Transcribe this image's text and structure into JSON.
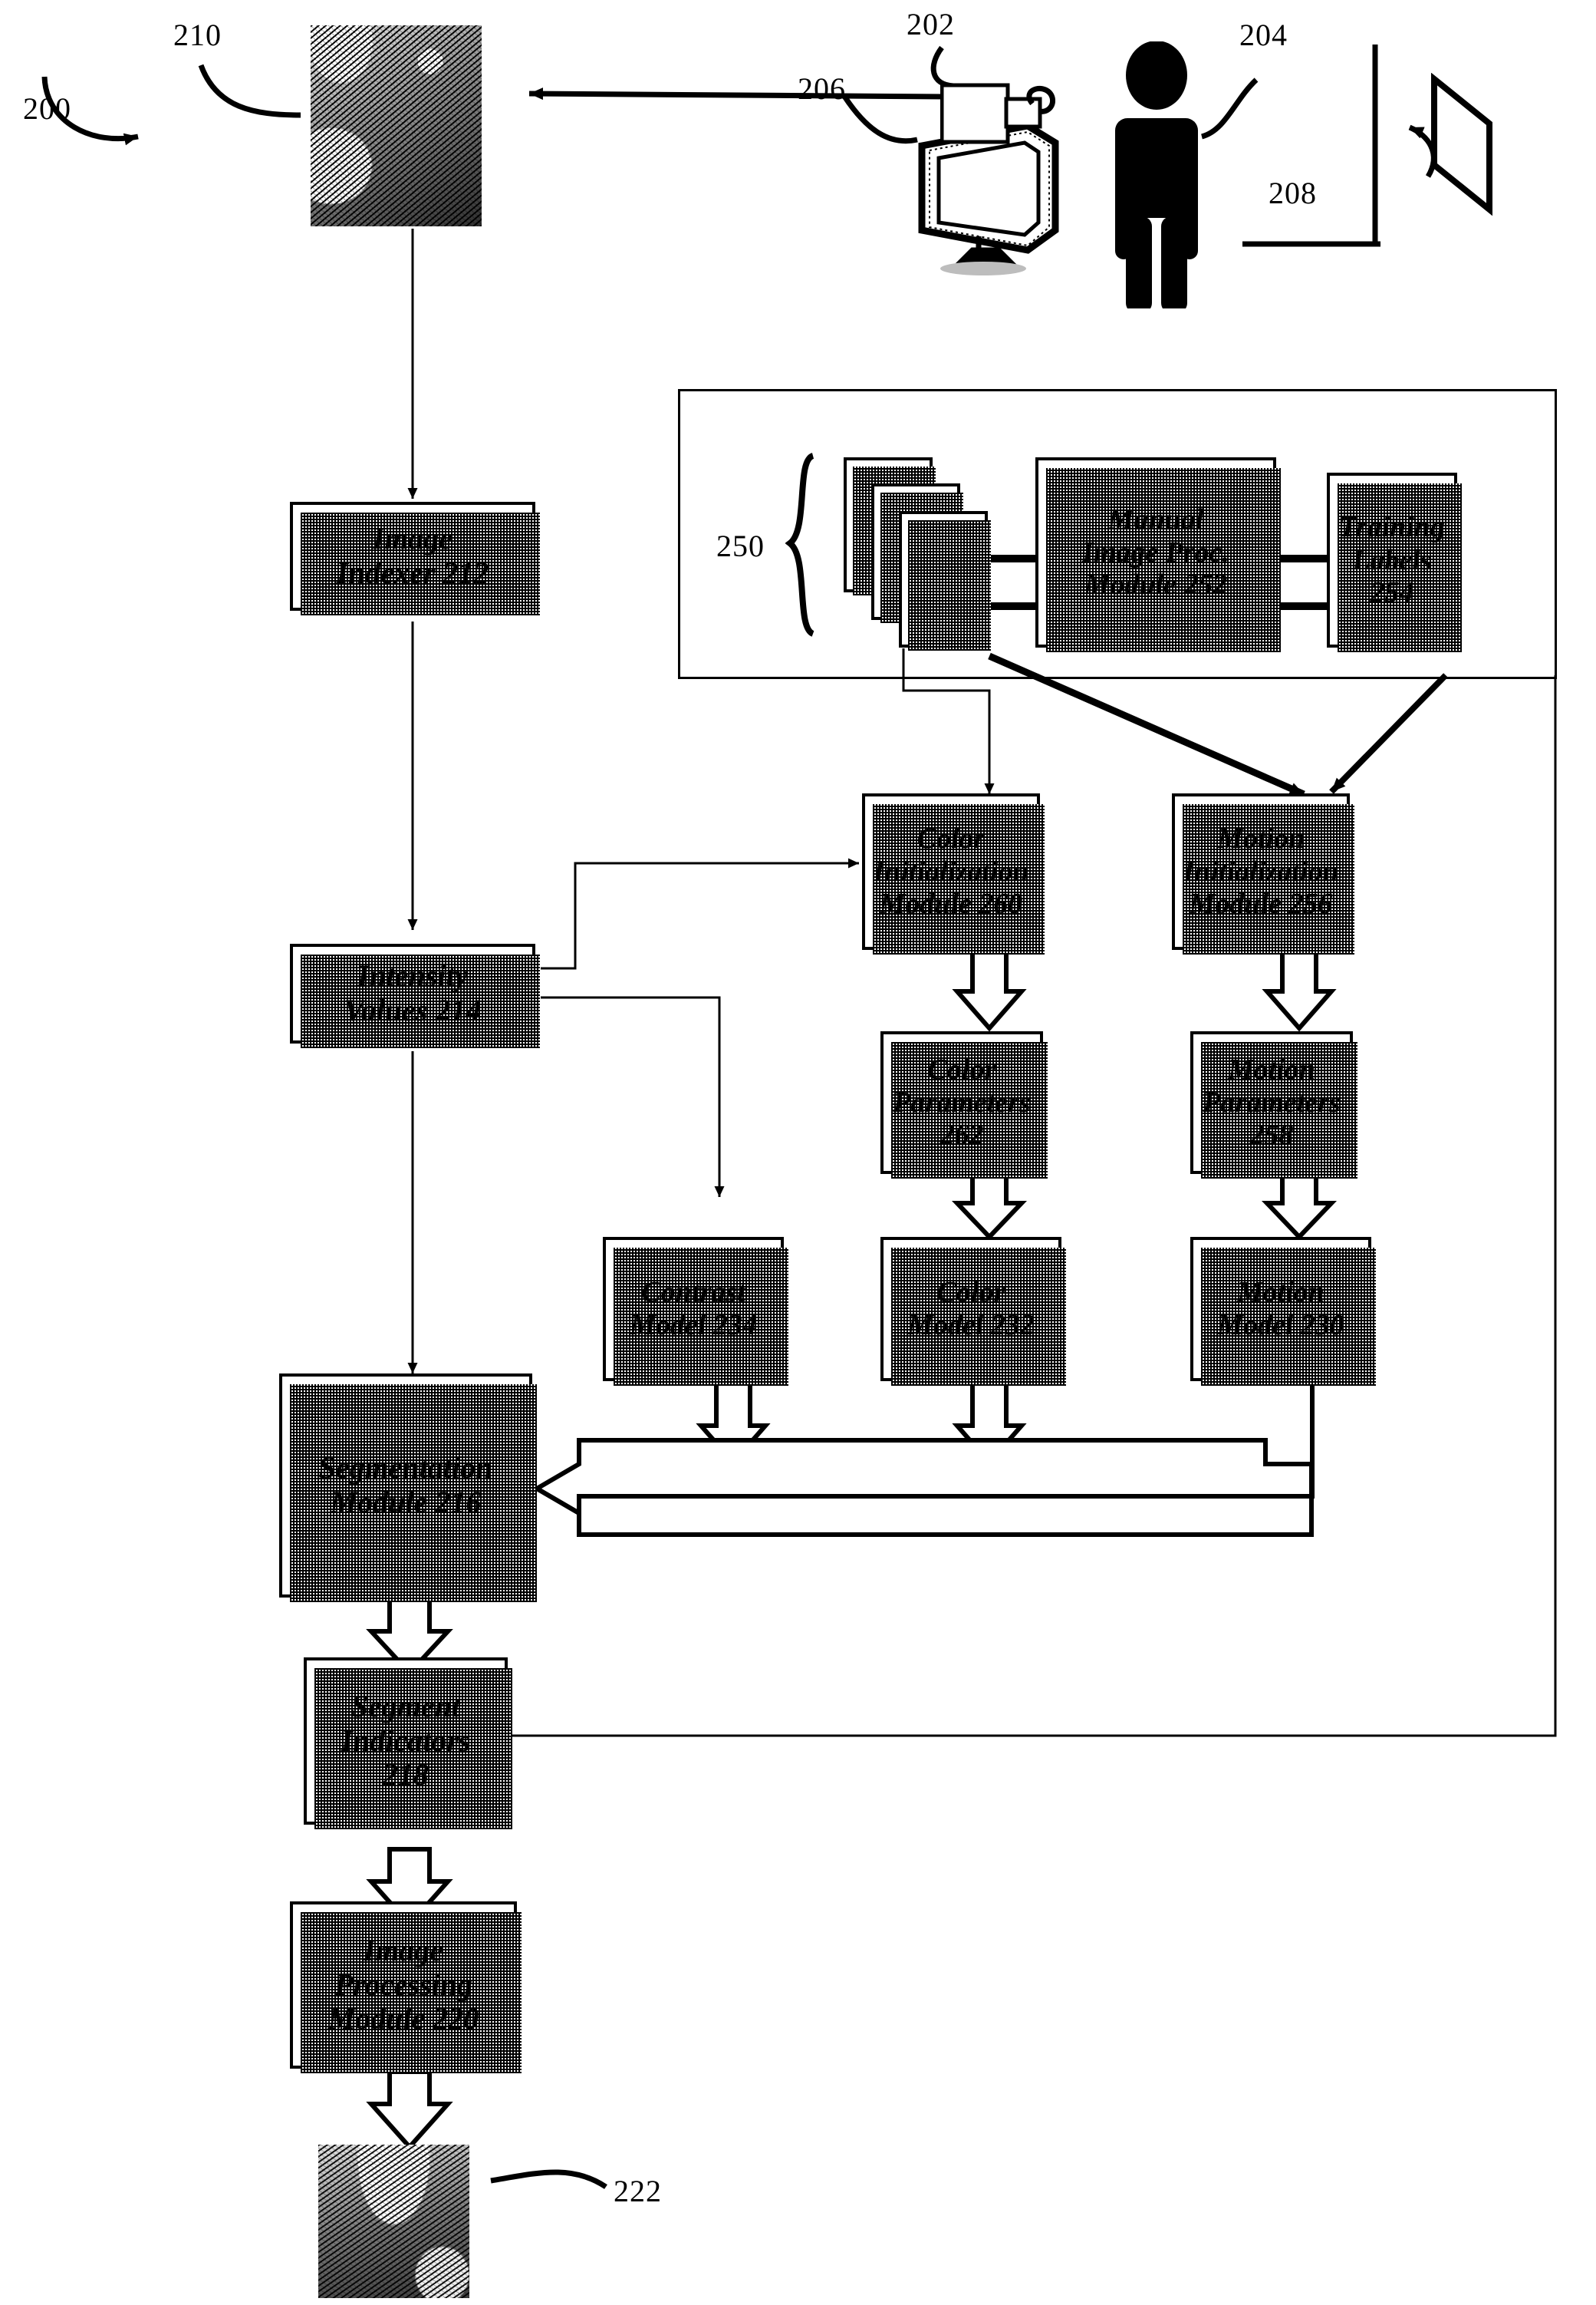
{
  "figure": {
    "id": "200",
    "type": "patent-block-diagram",
    "title": "Image segmentation system block diagram"
  },
  "reference_numerals": {
    "system": "200",
    "camera": "202",
    "person": "204",
    "monitor": "206",
    "display_panel": "208",
    "input_image": "210",
    "training_image_set": "250",
    "output_image": "222"
  },
  "boxes": {
    "image_indexer": {
      "label": "Image\nIndexer 212",
      "num": "212"
    },
    "intensity_values": {
      "label": "Intensity\nValues 214",
      "num": "214"
    },
    "manual_image_proc": {
      "label": "Manual\nImage Proc.\nModule 252",
      "num": "252"
    },
    "training_labels": {
      "label": "Training\nLabels\n254",
      "num": "254"
    },
    "color_init": {
      "label": "Color\nInitialization\nModule 260",
      "num": "260"
    },
    "motion_init": {
      "label": "Motion\nInitialization\nModule 256",
      "num": "256"
    },
    "color_params": {
      "label": "Color\nParameters\n262",
      "num": "262"
    },
    "motion_params": {
      "label": "Motion\nParameters\n258",
      "num": "258"
    },
    "contrast_model": {
      "label": "Contrast\nModel 234",
      "num": "234"
    },
    "color_model": {
      "label": "Color\nModel 232",
      "num": "232"
    },
    "motion_model": {
      "label": "Motion\nModel 230",
      "num": "230"
    },
    "segmentation_module": {
      "label": "Segmentation\nModule 216",
      "num": "216"
    },
    "segment_indicators": {
      "label": "Segment\nIndicators\n218",
      "num": "218"
    },
    "image_processing_module": {
      "label": "Image\nProcessing\nModule 220",
      "num": "220"
    }
  },
  "icons": {
    "camera": "camera-icon",
    "monitor": "monitor-icon",
    "person": "person-icon",
    "panel": "display-panel-icon",
    "brace": "curly-brace-icon",
    "image_210": "halftone-photo-icon",
    "image_222": "halftone-photo-icon"
  },
  "colors": {
    "ink": "#000000",
    "paper": "#ffffff"
  }
}
